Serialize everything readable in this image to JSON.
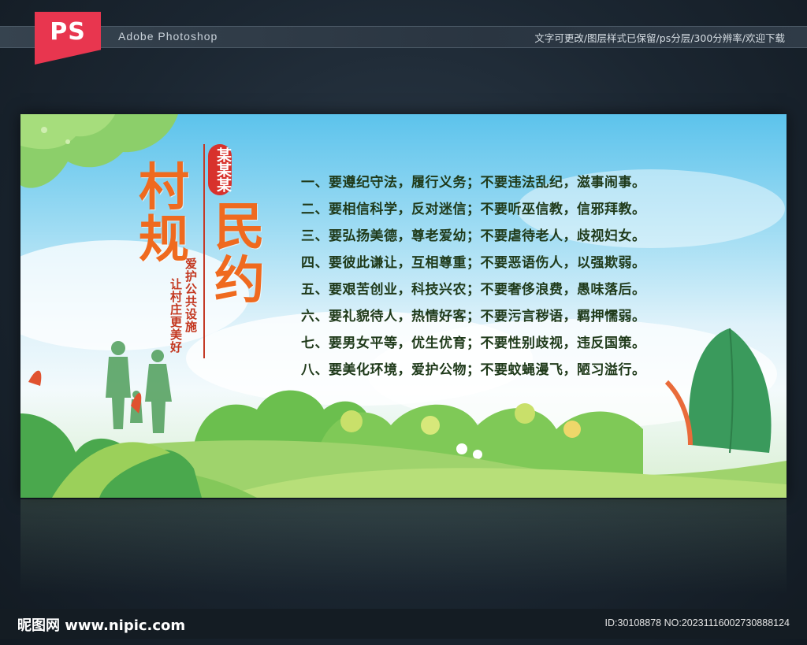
{
  "header": {
    "logo": "PS",
    "app_name": "Adobe Photoshop",
    "note": "文字可更改/图层样式已保留/ps分层/300分辨率/欢迎下载"
  },
  "poster": {
    "title_1": "村",
    "title_2": "规",
    "title_3": "民",
    "title_4": "约",
    "tag": "某某某",
    "subtitle_1": "爱护公共设施",
    "subtitle_2": "让村庄更美好",
    "rules": [
      "一、要遵纪守法，履行义务；不要违法乱纪，滋事闹事。",
      "二、要相信科学，反对迷信；不要听巫信教，信邪拜教。",
      "三、要弘扬美德，尊老爱幼；不要虐待老人，歧视妇女。",
      "四、要彼此谦让，互相尊重；不要恶语伤人，以强欺弱。",
      "五、要艰苦创业，科技兴农；不要奢侈浪费，愚味落后。",
      "六、要礼貌待人，热情好客；不要污言秽语，羁押懦弱。",
      "七、要男女平等，优生优育；不要性别歧视，违反国策。",
      "八、要美化环境，爱护公物；不要蚊蝇漫飞，陋习溢行。"
    ]
  },
  "footer": {
    "site": "昵图网 www.nipic.com",
    "id_text": "ID:30108878 NO:20231116002730888124"
  },
  "colors": {
    "brand_red": "#e8364f",
    "title_orange": "#ef6a1f",
    "tag_red": "#d8322c",
    "rule_text": "#1f3a1a"
  }
}
